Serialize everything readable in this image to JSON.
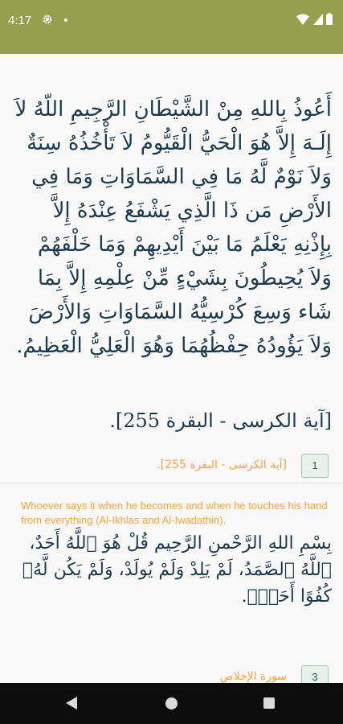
{
  "status_bar": {
    "time": "4:17",
    "icons": [
      "gear-icon",
      "notification-dot-icon",
      "wifi-icon",
      "signal-icon",
      "battery-icon"
    ]
  },
  "cards": [
    {
      "arabic_text": "أَعُوذُ بِاللهِ مِنْ الشَّيْطَانِ الرَّجِيمِ اللّهُ لاَ إِلَـهَ إِلاَّ هُوَ الْحَيُّ الْقَيُّومُ لاَ تَأْخُذُهُ سِنَةٌ وَلاَ نَوْمٌ لَّهُ مَا فِي السَّمَاوَاتِ وَمَا فِي الأَرْضِ مَن ذَا الَّذِي يَشْفَعُ عِنْدَهُ إِلاَّ بِإِذْنِهِ يَعْلَمُ مَا بَيْنَ أَيْدِيهِمْ وَمَا خَلْفَهُمْ وَلاَ يُحِيطُونَ بِشَيْءٍ مِّنْ عِلْمِهِ إِلاَّ بِمَا شَاء وَسِعَ كُرْسِيُّهُ السَّمَاوَاتِ وَالأَرْضَ وَلاَ يَؤُودُهُ حِفْظُهُمَا وَهُوَ الْعَلِيُّ الْعَظِيمُ.",
      "inline_reference": "[آية الكرسى - البقرة 255].",
      "reference": "[آية الكرسى - البقرة 255].",
      "count": "1"
    },
    {
      "virtue": "Whoever says it when he becomes and when he touches his hand from everything (Al-Ikhlas and Al-Iwadathin).",
      "arabic_text": "بِسْمِ اللهِ الرَّحْمنِ الرَّحِيم قُلْ هُوَ ٱللَّهُ أَحَدٌ، ٱللَّهُ ٱلصَّمَدُ، لَمْ يَلِدْ وَلَمْ يُولَدْ، وَلَمْ يَكُن لَّهُۥ كُفُوًا أَحَدٌۢ.",
      "reference": "سورة الإخلاص",
      "count": "3"
    }
  ],
  "nav_bar": {
    "icons": [
      "back-icon",
      "home-icon",
      "recents-icon"
    ]
  },
  "colors": {
    "status_bar": "#95a04f",
    "arabic_text": "#1d3b4e",
    "reference_orange": "#f2a23c",
    "badge_bg": "#e8f1eb",
    "nav_bar": "#0d0d0d"
  }
}
